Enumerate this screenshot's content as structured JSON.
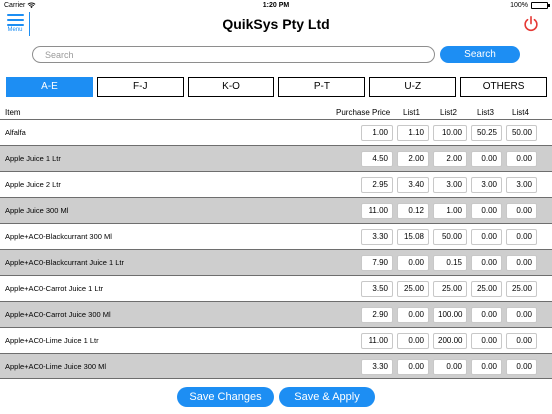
{
  "status_bar": {
    "carrier": "Carrier",
    "time": "1:20 PM",
    "battery": "100%"
  },
  "header": {
    "menu_label": "Menu",
    "title": "QuikSys Pty Ltd"
  },
  "search": {
    "placeholder": "Search",
    "button_label": "Search"
  },
  "tabs": [
    {
      "label": "A-E",
      "active": true
    },
    {
      "label": "F-J",
      "active": false
    },
    {
      "label": "K-O",
      "active": false
    },
    {
      "label": "P-T",
      "active": false
    },
    {
      "label": "U-Z",
      "active": false
    },
    {
      "label": "OTHERS",
      "active": false
    }
  ],
  "table": {
    "columns": {
      "item": "Item",
      "purchase_price": "Purchase Price",
      "list1": "List1",
      "list2": "List2",
      "list3": "List3",
      "list4": "List4"
    },
    "rows": [
      {
        "item": "Alfalfa",
        "values": [
          "1.00",
          "1.10",
          "10.00",
          "50.25",
          "50.00"
        ]
      },
      {
        "item": "Apple Juice 1 Ltr",
        "values": [
          "4.50",
          "2.00",
          "2.00",
          "0.00",
          "0.00"
        ]
      },
      {
        "item": "Apple Juice 2 Ltr",
        "values": [
          "2.95",
          "3.40",
          "3.00",
          "3.00",
          "3.00"
        ]
      },
      {
        "item": "Apple Juice 300 Ml",
        "values": [
          "11.00",
          "0.12",
          "1.00",
          "0.00",
          "0.00"
        ]
      },
      {
        "item": "Apple+AC0-Blackcurrant 300 Ml",
        "values": [
          "3.30",
          "15.08",
          "50.00",
          "0.00",
          "0.00"
        ]
      },
      {
        "item": "Apple+AC0-Blackcurrant Juice 1 Ltr",
        "values": [
          "7.90",
          "0.00",
          "0.15",
          "0.00",
          "0.00"
        ]
      },
      {
        "item": "Apple+AC0-Carrot Juice 1 Ltr",
        "values": [
          "3.50",
          "25.00",
          "25.00",
          "25.00",
          "25.00"
        ]
      },
      {
        "item": "Apple+AC0-Carrot Juice 300 Ml",
        "values": [
          "2.90",
          "0.00",
          "100.00",
          "0.00",
          "0.00"
        ]
      },
      {
        "item": "Apple+AC0-Lime Juice 1 Ltr",
        "values": [
          "11.00",
          "0.00",
          "200.00",
          "0.00",
          "0.00"
        ]
      },
      {
        "item": "Apple+AC0-Lime Juice 300 Ml",
        "values": [
          "3.30",
          "0.00",
          "0.00",
          "0.00",
          "0.00"
        ]
      }
    ]
  },
  "footer": {
    "save_changes_label": "Save Changes",
    "save_apply_label": "Save & Apply"
  },
  "colors": {
    "accent": "#1d8ef3",
    "power": "#e53935",
    "alt_row": "#cecece"
  },
  "icons": {
    "menu": "hamburger-icon",
    "power": "power-icon",
    "wifi": "wifi-icon",
    "battery": "battery-icon"
  }
}
